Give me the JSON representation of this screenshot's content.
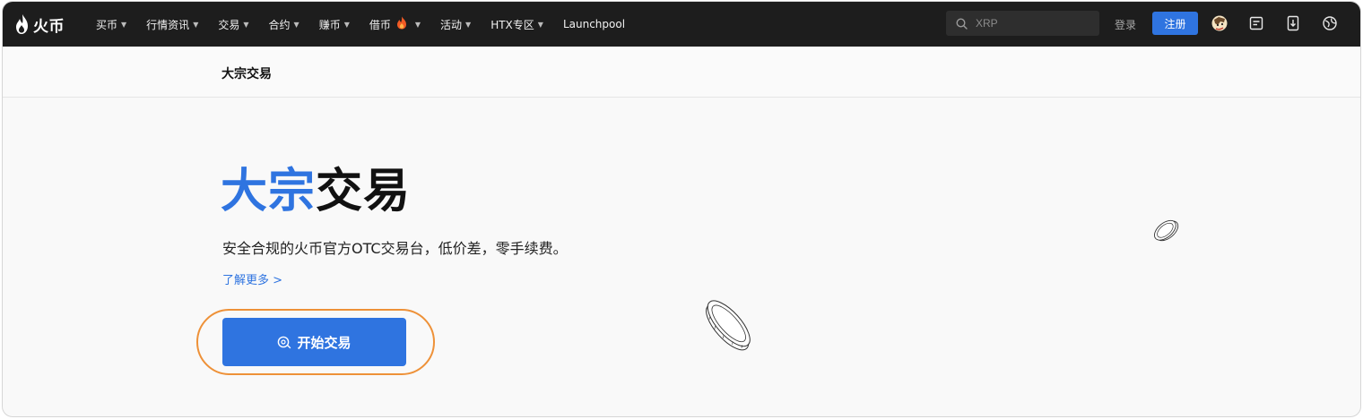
{
  "brand": {
    "name": "火币"
  },
  "nav": {
    "items": [
      {
        "label": "买币",
        "caret": true
      },
      {
        "label": "行情资讯",
        "caret": true
      },
      {
        "label": "交易",
        "caret": true
      },
      {
        "label": "合约",
        "caret": true
      },
      {
        "label": "赚币",
        "caret": true
      },
      {
        "label": "借币",
        "caret": true,
        "hot": true
      },
      {
        "label": "活动",
        "caret": true
      },
      {
        "label": "HTX专区",
        "caret": true
      },
      {
        "label": "Launchpool",
        "caret": false
      }
    ]
  },
  "search": {
    "placeholder": "XRP"
  },
  "auth": {
    "login": "登录",
    "register": "注册"
  },
  "icons": [
    "avatar-icon",
    "orders-icon",
    "download-icon",
    "language-globe-icon"
  ],
  "subheader": {
    "title": "大宗交易"
  },
  "hero": {
    "title_blue": "大宗",
    "title_black": "交易",
    "description": "安全合规的火币官方OTC交易台，低价差，零手续费。",
    "learn_more": "了解更多 >",
    "cta": "开始交易"
  },
  "colors": {
    "accent": "#2f74e0",
    "topbar": "#1d1d1d",
    "highlight_ring": "#ee9138"
  }
}
